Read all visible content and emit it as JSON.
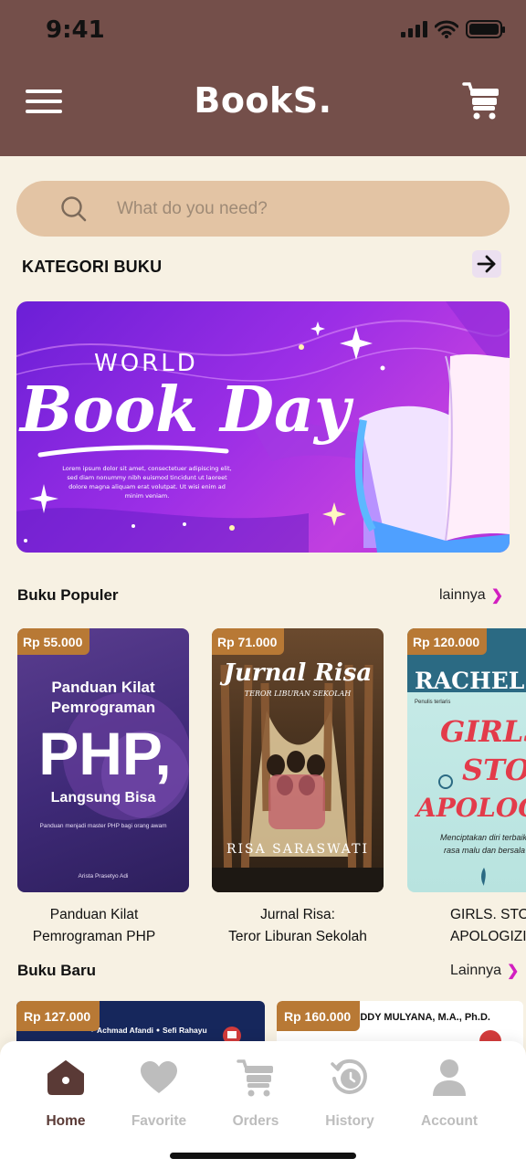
{
  "status_bar": {
    "time": "9:41"
  },
  "header": {
    "logo": "BookS."
  },
  "search": {
    "placeholder": "What do you need?"
  },
  "categories": {
    "title": "KATEGORI BUKU"
  },
  "banner": {
    "headline_small": "WORLD",
    "headline_big": "Book Day",
    "body": "Lorem ipsum dolor sit amet, consectetuer adipiscing elit, sed diam nonummy nibh euismod tincidunt ut laoreet dolore magna aliquam erat volutpat. Ut wisi enim ad minim veniam."
  },
  "popular": {
    "title": "Buku Populer",
    "more": "lainnya",
    "books": [
      {
        "price": "Rp 55.000",
        "title_line1": "Panduan Kilat",
        "title_line2": "Pemrograman PHP",
        "cover": {
          "line1": "Panduan Kilat",
          "line2": "Pemrograman",
          "big": "PHP,",
          "line3": "Langsung Bisa",
          "tagline": "Panduan menjadi master PHP bagi orang awam",
          "author": "Arista Prasetyo Adi"
        }
      },
      {
        "price": "Rp 71.000",
        "title_line1": "Jurnal Risa:",
        "title_line2": "Teror Liburan Sekolah",
        "cover": {
          "title": "Jurnal Risa",
          "subtitle": "TEROR LIBURAN SEKOLAH",
          "author": "RISA SARASWATI"
        }
      },
      {
        "price": "Rp 120.000",
        "title_line1": "GIRLS. STOP",
        "title_line2": "APOLOGIZING",
        "cover": {
          "author": "RACHEL HOL",
          "tagline": "Penulis terlaris",
          "line1": "GIRLS",
          "line2": "STOP",
          "line3": "APOLOGIZ",
          "sub1": "Menciptakan diri terbaik",
          "sub2": "rasa malu dan bersala"
        }
      }
    ]
  },
  "new_books": {
    "title": "Buku Baru",
    "more": "Lainnya",
    "books": [
      {
        "price": "Rp 127.000",
        "author1": "Achmad Afandi",
        "author2": "Sefi Rahayu"
      },
      {
        "price": "Rp 160.000",
        "author": "EDDY MULYANA, M.A., Ph.D."
      }
    ]
  },
  "tabs": [
    {
      "label": "Home",
      "icon": "home-icon",
      "active": true
    },
    {
      "label": "Favorite",
      "icon": "heart-icon",
      "active": false
    },
    {
      "label": "Orders",
      "icon": "cart-icon",
      "active": false
    },
    {
      "label": "History",
      "icon": "history-icon",
      "active": false
    },
    {
      "label": "Account",
      "icon": "user-icon",
      "active": false
    }
  ],
  "colors": {
    "header": "#744f4a",
    "background": "#f7f1e3",
    "search": "#e3c4a4",
    "price_tag": "#b87935",
    "accent_chevron": "#d21fc0",
    "tab_active": "#5a3a36",
    "tab_inactive": "#bdbdbd"
  }
}
